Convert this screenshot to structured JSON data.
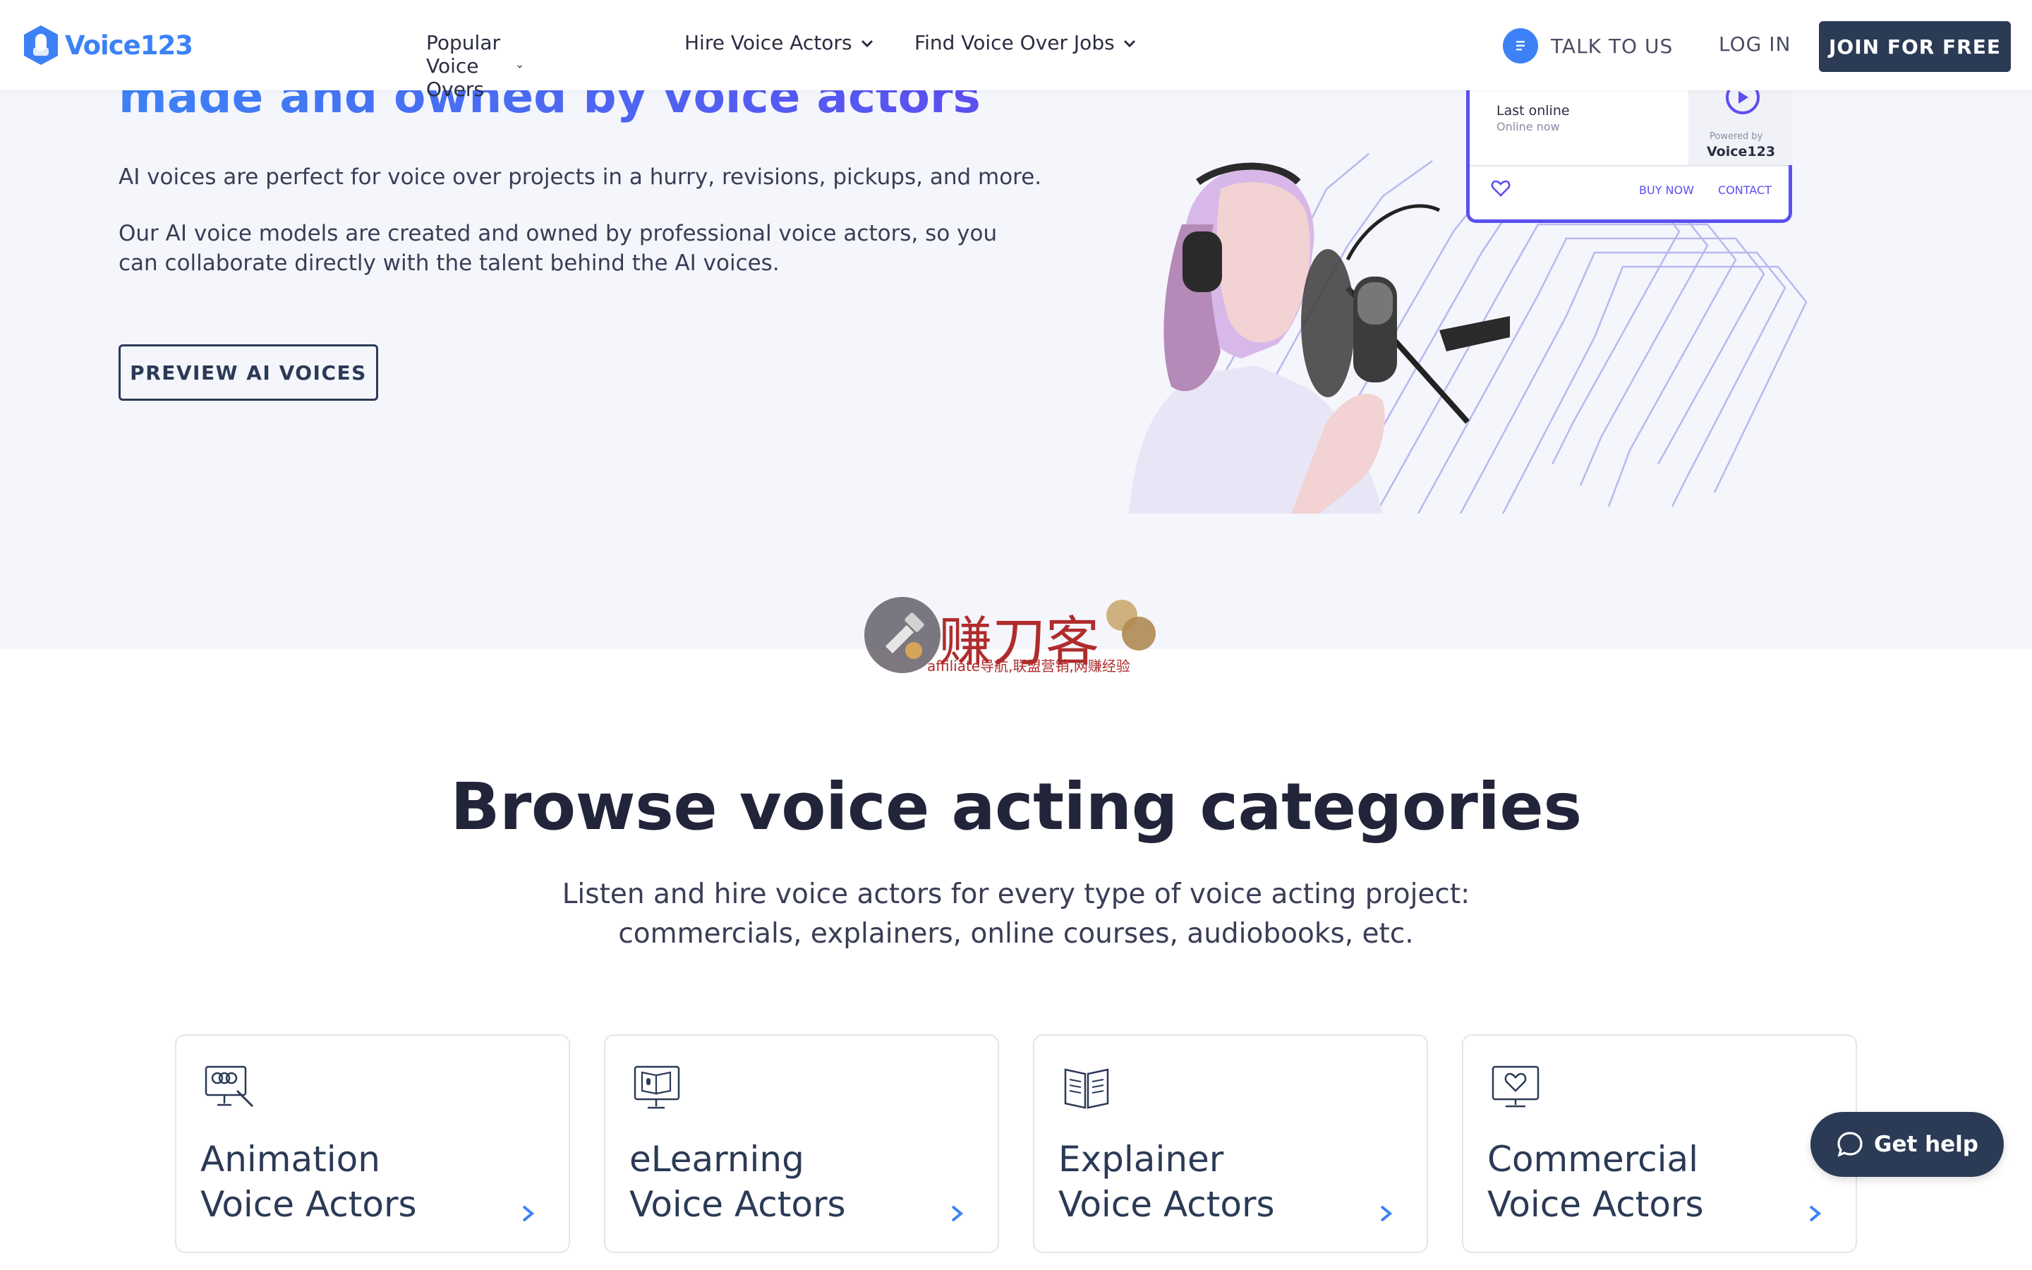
{
  "brand": {
    "name": "Voice123",
    "color": "#3c82f6"
  },
  "nav": {
    "items": [
      {
        "label": "Popular Voice Overs"
      },
      {
        "label": "Hire Voice Actors"
      },
      {
        "label": "Find Voice Over Jobs"
      }
    ],
    "talk_label": "TALK TO US",
    "login_label": "LOG IN",
    "join_label": "JOIN FOR FREE"
  },
  "hero": {
    "title": "made and owned by voice actors",
    "p1": "AI voices are perfect for voice over projects in a hurry, revisions, pickups, and more.",
    "p2": "Our AI voice models are created and owned by professional voice actors, so you can collaborate directly with the talent behind the AI voices.",
    "preview_label": "PREVIEW AI VOICES",
    "card": {
      "last_online_label": "Last online",
      "online_status": "Online now",
      "powered_by": "Powered by",
      "brand": "Voice123",
      "buy_label": "BUY NOW",
      "contact_label": "CONTACT"
    }
  },
  "watermark": {
    "title": "赚刀客",
    "subtitle": "affiliate导航,联盟营销,网赚经验"
  },
  "categories": {
    "title": "Browse voice acting categories",
    "subtitle_line1": "Listen and hire voice actors for every type of voice acting project:",
    "subtitle_line2": "commercials, explainers, online courses, audiobooks, etc.",
    "cards": [
      {
        "line1": "Animation",
        "line2": "Voice Actors",
        "icon": "animation-monitor-icon"
      },
      {
        "line1": "eLearning",
        "line2": "Voice Actors",
        "icon": "elearning-monitor-icon"
      },
      {
        "line1": "Explainer",
        "line2": "Voice Actors",
        "icon": "open-book-icon"
      },
      {
        "line1": "Commercial",
        "line2": "Voice Actors",
        "icon": "monitor-heart-icon"
      }
    ]
  },
  "help": {
    "label": "Get help"
  },
  "colors": {
    "accent": "#3c82f6",
    "purple": "#5b4ff0",
    "navy": "#2b3a55",
    "hero_bg": "#f4f6fc"
  }
}
